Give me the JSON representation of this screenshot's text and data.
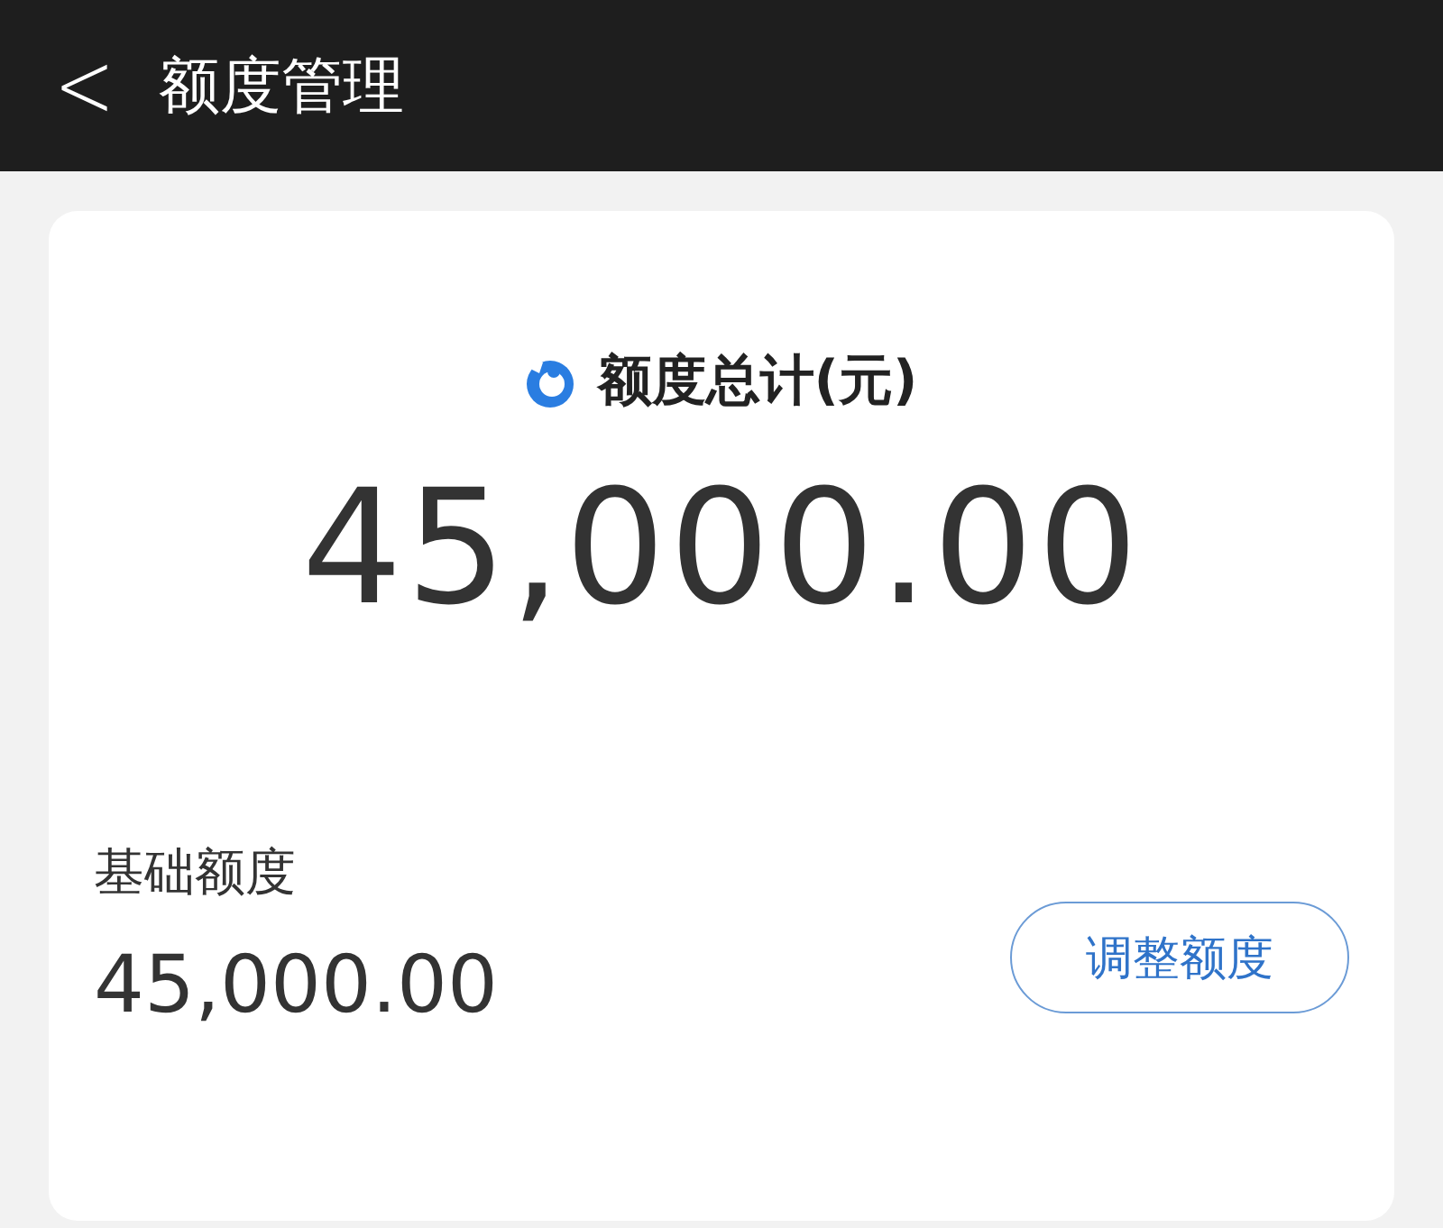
{
  "header": {
    "back": "<",
    "title": "额度管理"
  },
  "total": {
    "label": "额度总计(元)",
    "amount": "45,000.00"
  },
  "base": {
    "label": "基础额度",
    "amount": "45,000.00"
  },
  "adjust_button": {
    "label": "调整额度"
  }
}
